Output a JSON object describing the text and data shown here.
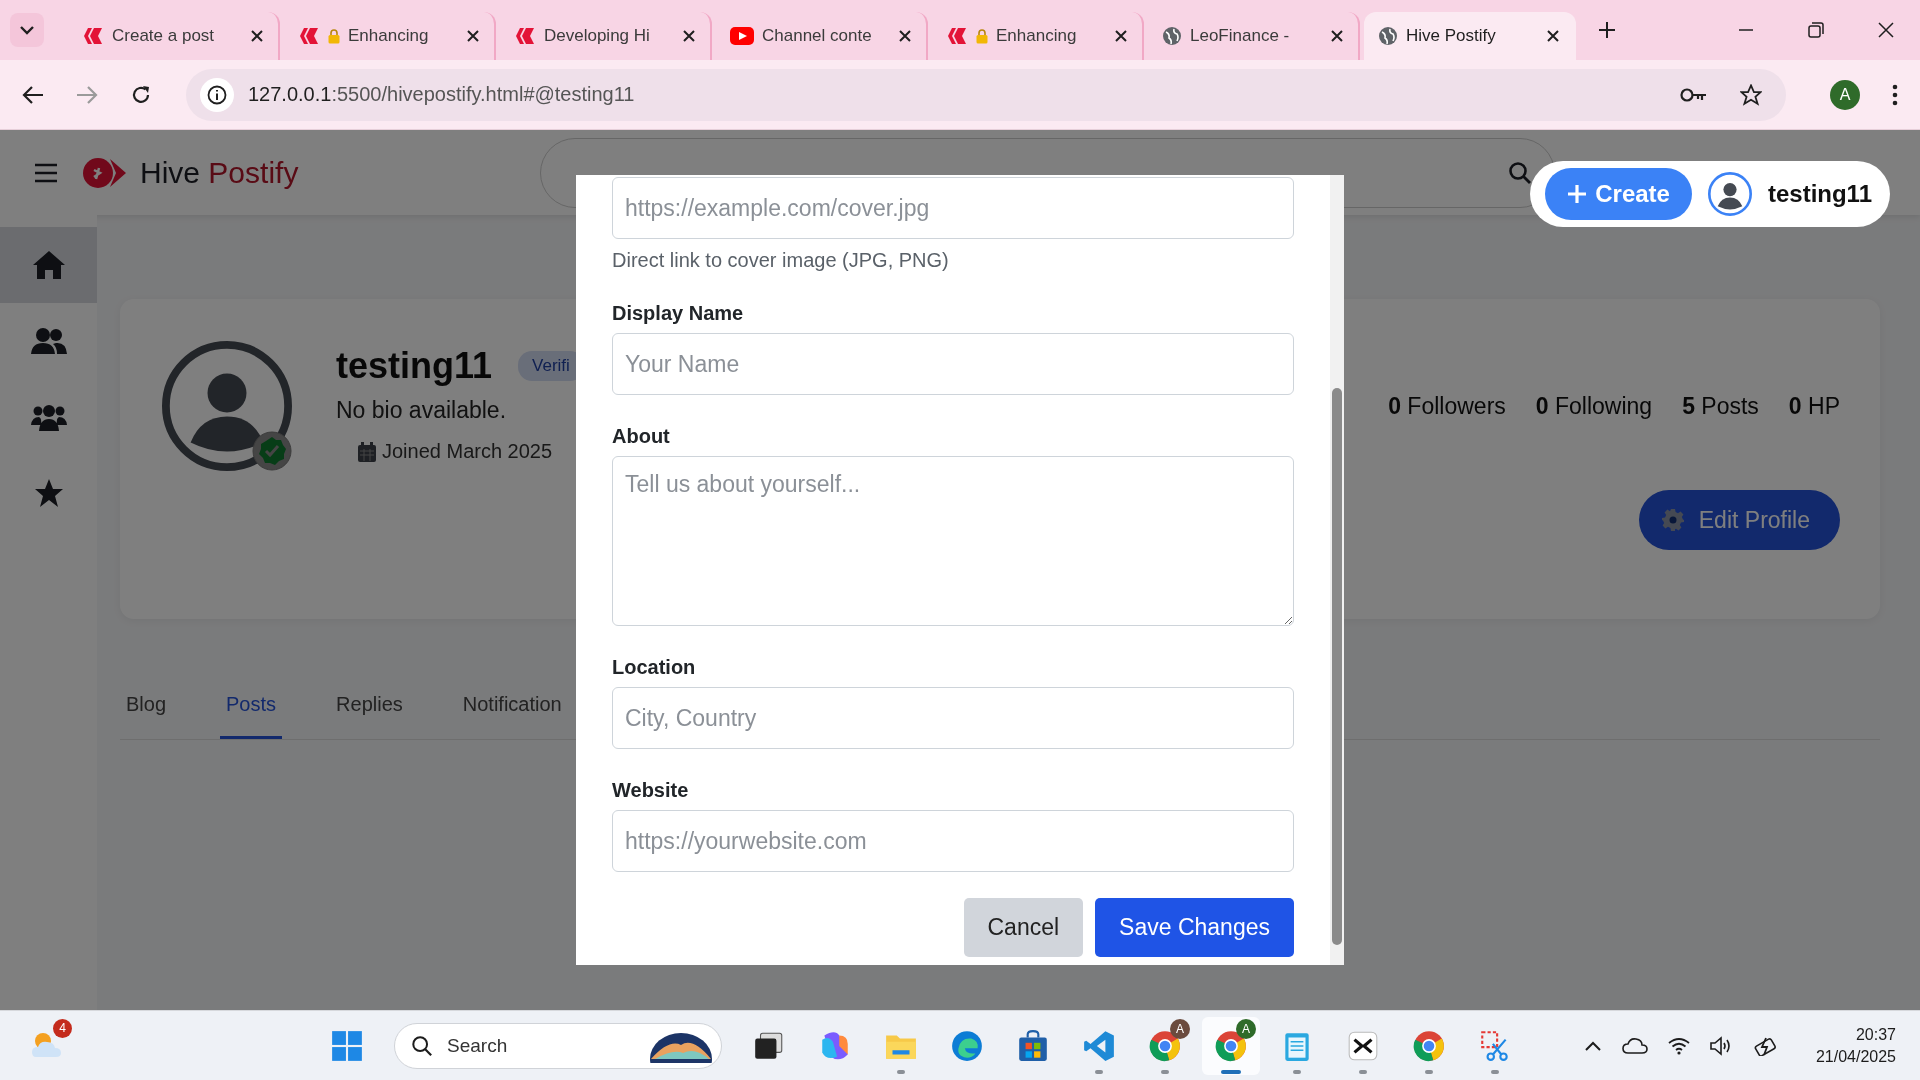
{
  "browser": {
    "tabs": [
      {
        "title": "Create a post",
        "kind": "hive",
        "locked": false,
        "selected": false
      },
      {
        "title": "Enhancing",
        "kind": "hive",
        "locked": true,
        "selected": false
      },
      {
        "title": "Developing Hi",
        "kind": "hive",
        "locked": false,
        "selected": false
      },
      {
        "title": "Channel conte",
        "kind": "video",
        "locked": false,
        "selected": false
      },
      {
        "title": "Enhancing",
        "kind": "hive",
        "locked": true,
        "selected": false
      },
      {
        "title": "LeoFinance -",
        "kind": "globe",
        "locked": false,
        "selected": false
      },
      {
        "title": "Hive Postify",
        "kind": "globe",
        "locked": false,
        "selected": true
      }
    ],
    "url_host": "127.0.0.1",
    "url_rest": ":5500/hivepostify.html#@testing11",
    "profile_initial": "A"
  },
  "app": {
    "brand_first": "Hive",
    "brand_second": "Postify",
    "create_button": "Create",
    "user": "testing11",
    "sidebar": [
      {
        "kind": "home",
        "selected": true
      },
      {
        "kind": "people",
        "selected": false
      },
      {
        "kind": "group",
        "selected": false
      },
      {
        "kind": "star",
        "selected": false
      }
    ]
  },
  "profile": {
    "name": "testing11",
    "badge": "Verifi",
    "bio": "No bio available.",
    "joined": "Joined March 2025",
    "verified": true,
    "stats": [
      "**0** Followers",
      "**0** Following",
      "**5** Posts",
      "**0** HP"
    ],
    "edit_button": "Edit Profile"
  },
  "content_tabs": [
    {
      "label": "Blog",
      "selected": false
    },
    {
      "label": "Posts",
      "selected": true
    },
    {
      "label": "Replies",
      "selected": false
    },
    {
      "label": "Notification",
      "selected": false
    }
  ],
  "modal": {
    "cover": {
      "placeholder": "https://example.com/cover.jpg",
      "help": "Direct link to cover image (JPG, PNG)"
    },
    "fields": [
      {
        "kind": "input",
        "label": "Display Name",
        "placeholder": "Your Name"
      },
      {
        "kind": "textarea",
        "label": "About",
        "placeholder": "Tell us about yourself..."
      },
      {
        "kind": "input",
        "label": "Location",
        "placeholder": "City, Country"
      },
      {
        "kind": "input",
        "label": "Website",
        "placeholder": "https://yourwebsite.com"
      }
    ],
    "cancel_button": "Cancel",
    "save_button": "Save Changes"
  },
  "taskbar": {
    "weather_badge": "4",
    "search_placeholder": "Search",
    "apps": [
      {
        "kind": "start",
        "running": false,
        "active": false
      },
      {
        "kind": "taskview",
        "running": false,
        "active": false
      },
      {
        "kind": "copilot",
        "running": false,
        "active": false
      },
      {
        "kind": "folder",
        "running": true,
        "active": false
      },
      {
        "kind": "edge",
        "running": false,
        "active": false
      },
      {
        "kind": "store",
        "running": false,
        "active": false
      },
      {
        "kind": "code",
        "running": true,
        "active": false
      },
      {
        "kind": "browser",
        "badge": "A",
        "running": true,
        "active": false
      },
      {
        "kind": "browser",
        "badge": "A",
        "running": true,
        "active": true
      },
      {
        "kind": "notepad",
        "running": true,
        "active": false
      },
      {
        "kind": "editor",
        "running": true,
        "active": false
      },
      {
        "kind": "browser",
        "running": true,
        "active": false
      },
      {
        "kind": "snip",
        "running": true,
        "active": false
      }
    ],
    "time": "20:37",
    "date": "21/04/2025"
  }
}
